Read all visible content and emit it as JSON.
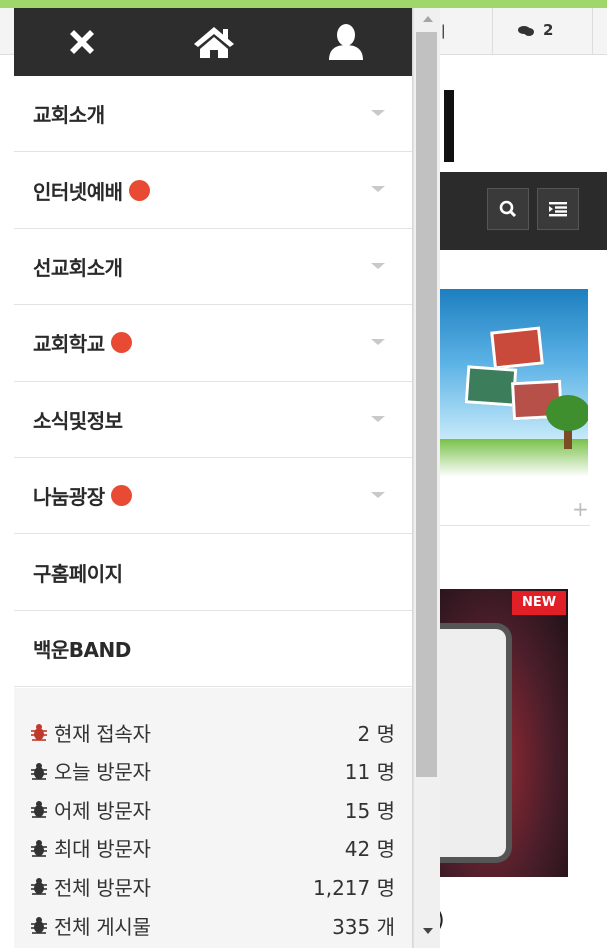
{
  "header": {
    "close_icon": "close-icon",
    "home_icon": "home-icon",
    "user_icon": "user-icon"
  },
  "menu": {
    "items": [
      {
        "label": "교회소개",
        "has_new": false,
        "has_submenu": true
      },
      {
        "label": "인터넷예배",
        "has_new": true,
        "has_submenu": true
      },
      {
        "label": "선교회소개",
        "has_new": false,
        "has_submenu": true
      },
      {
        "label": "교회학교",
        "has_new": true,
        "has_submenu": true
      },
      {
        "label": "소식및정보",
        "has_new": false,
        "has_submenu": true
      },
      {
        "label": "나눔광장",
        "has_new": true,
        "has_submenu": true
      },
      {
        "label": "구홈페이지",
        "has_new": false,
        "has_submenu": false
      },
      {
        "label": "백운BAND",
        "has_new": false,
        "has_submenu": false
      }
    ],
    "new_dot_color": "#e84a33"
  },
  "stats": [
    {
      "label": "현재 접속자",
      "value": "2 명",
      "icon_color": "#c0392b"
    },
    {
      "label": "오늘 방문자",
      "value": "11 명",
      "icon_color": "#333333"
    },
    {
      "label": "어제 방문자",
      "value": "15 명",
      "icon_color": "#333333"
    },
    {
      "label": "최대 방문자",
      "value": "42 명",
      "icon_color": "#333333"
    },
    {
      "label": "전체 방문자",
      "value": "1,217 명",
      "icon_color": "#333333"
    },
    {
      "label": "전체 게시물",
      "value": "335 개",
      "icon_color": "#333333"
    }
  ],
  "background_page": {
    "topbar_partial_text": "기",
    "comment_count": "2",
    "new_badge": "NEW",
    "bottom_partial_text": ")"
  },
  "colors": {
    "header_bg": "#2d2d2d",
    "page_frame": "#9fd86a",
    "new_badge": "#e01f26"
  }
}
